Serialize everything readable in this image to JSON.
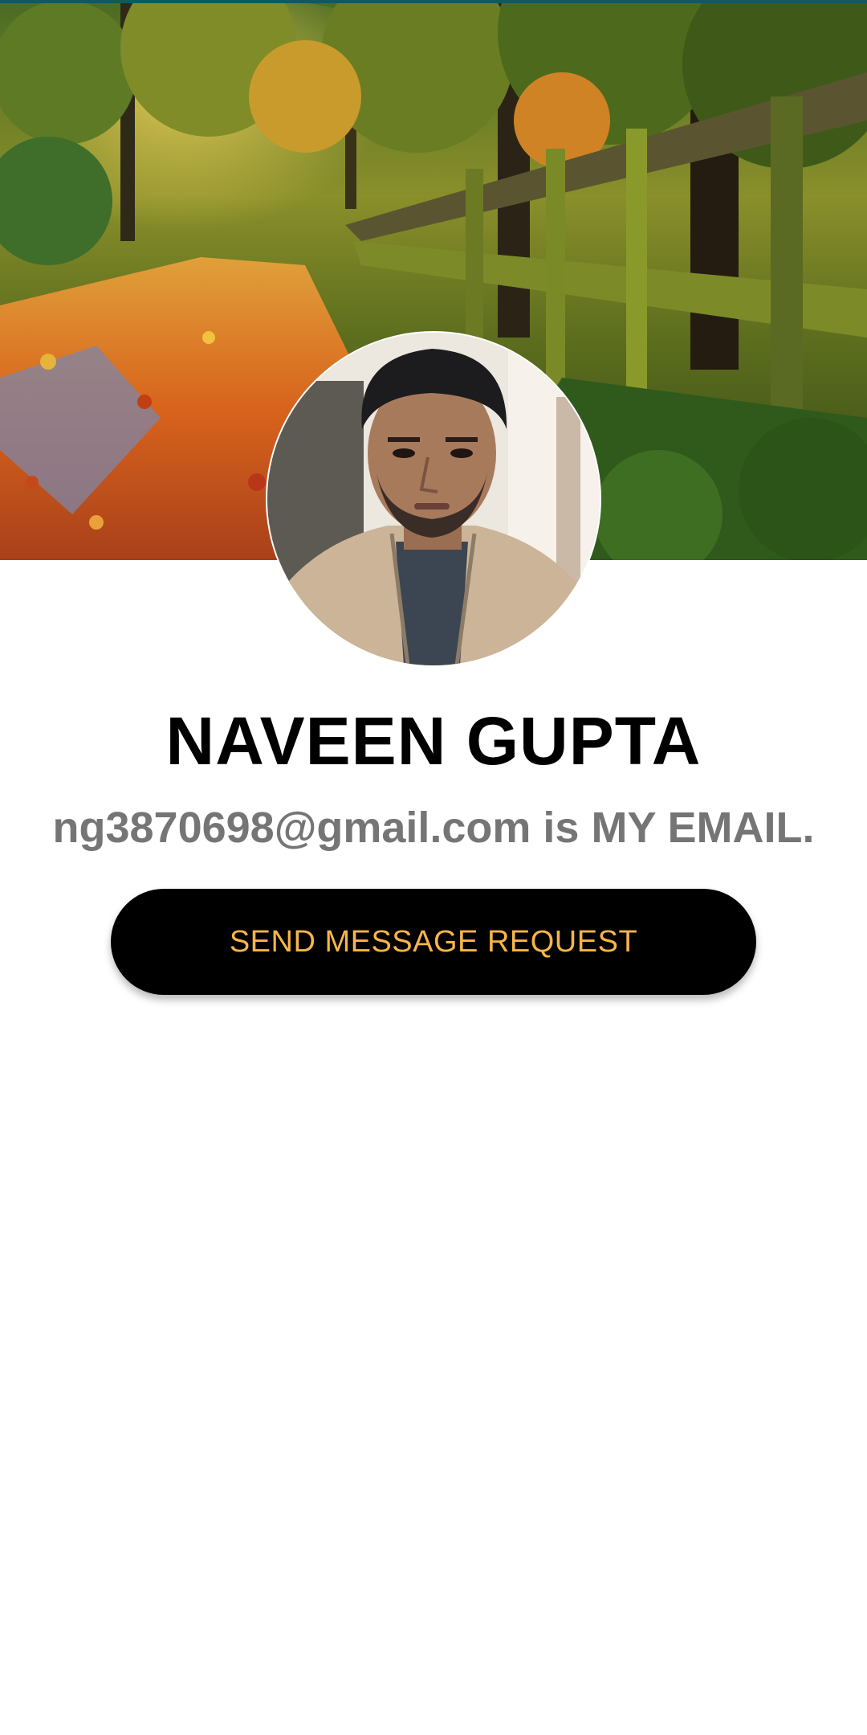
{
  "profile": {
    "name": "NAVEEN GUPTA",
    "email_line": "ng3870698@gmail.com is MY EMAIL.",
    "cover_image": "autumn-forest-path-photo",
    "avatar_image": "profile-photo"
  },
  "actions": {
    "send_request_label": "SEND MESSAGE REQUEST"
  },
  "colors": {
    "button_bg": "#000000",
    "button_text": "#f7b548",
    "name_text": "#000000",
    "email_text": "#757575",
    "background": "#ffffff"
  }
}
